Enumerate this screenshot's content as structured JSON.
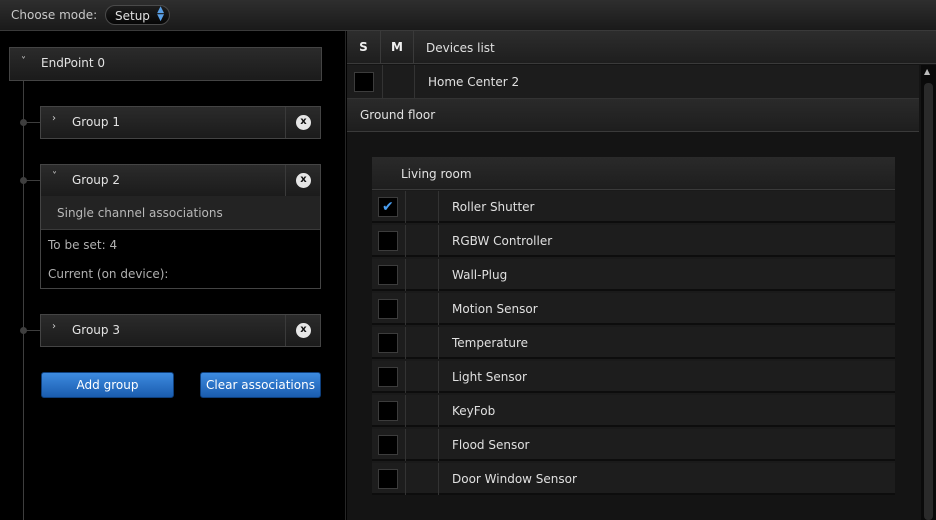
{
  "topbar": {
    "mode_label": "Choose mode:",
    "mode_value": "Setup"
  },
  "left": {
    "endpoint": "EndPoint 0",
    "groups": [
      {
        "label": "Group 1",
        "expanded": false
      },
      {
        "label": "Group 2",
        "expanded": true,
        "subheader": "Single channel associations",
        "to_be_set": "To be set: 4",
        "current": "Current (on device):"
      },
      {
        "label": "Group 3",
        "expanded": false
      }
    ],
    "close_glyph": "x",
    "add_group": "Add group",
    "clear_associations": "Clear associations"
  },
  "right": {
    "headers": {
      "s": "S",
      "m": "M",
      "title": "Devices list"
    },
    "home_center": "Home Center 2",
    "floor": "Ground floor",
    "room": "Living room",
    "devices": [
      {
        "name": "Roller Shutter",
        "checked": true
      },
      {
        "name": "RGBW Controller",
        "checked": false
      },
      {
        "name": "Wall-Plug",
        "checked": false
      },
      {
        "name": "Motion Sensor",
        "checked": false
      },
      {
        "name": "Temperature",
        "checked": false
      },
      {
        "name": "Light Sensor",
        "checked": false
      },
      {
        "name": "KeyFob",
        "checked": false
      },
      {
        "name": "Flood Sensor",
        "checked": false
      },
      {
        "name": "Door Window Sensor",
        "checked": false
      }
    ]
  },
  "colors": {
    "accent": "#2f7bd4",
    "check": "#4a9ef0"
  }
}
